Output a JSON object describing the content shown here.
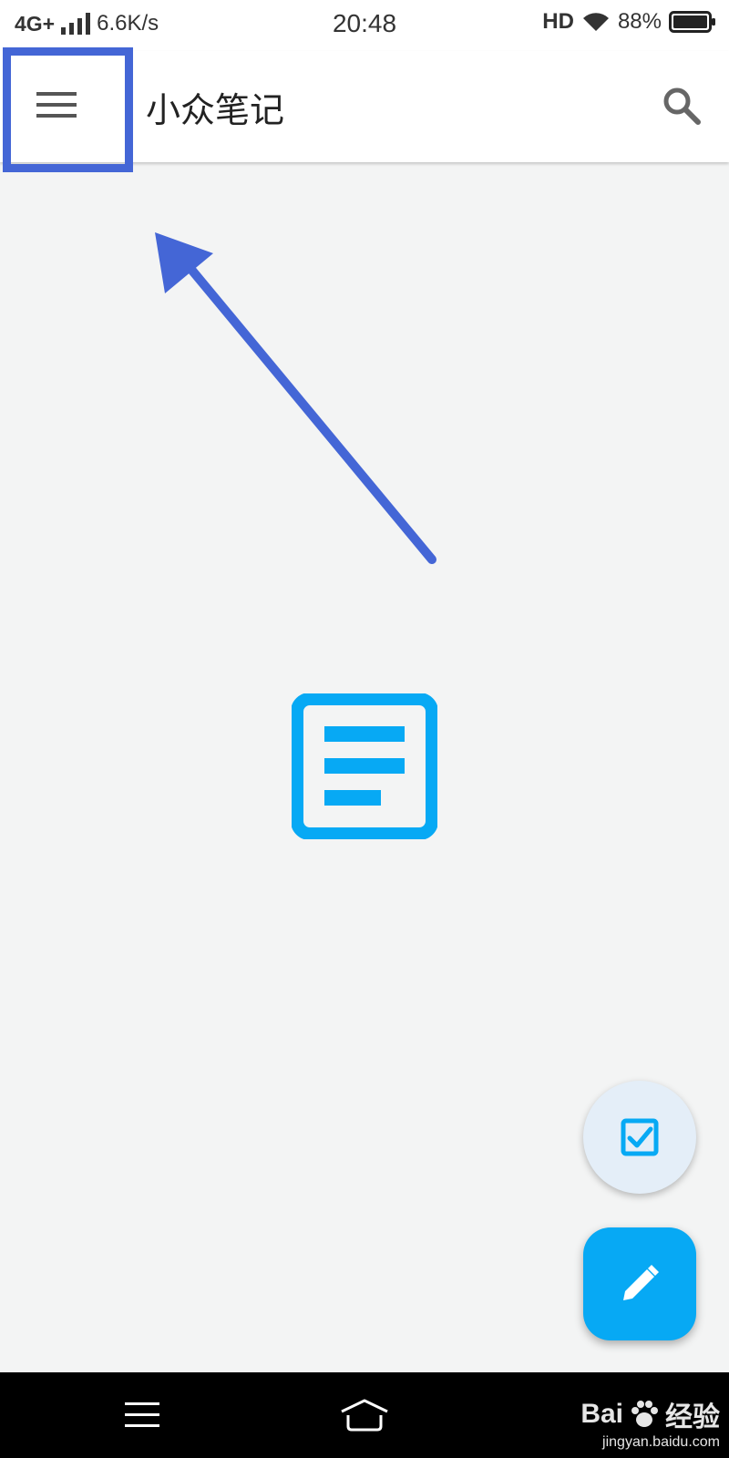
{
  "status_bar": {
    "network": "4G+",
    "speed": "6.6K/s",
    "time": "20:48",
    "hd": "HD",
    "battery": "88%"
  },
  "app_bar": {
    "title": "小众笔记",
    "menu_icon": "hamburger-menu-icon",
    "search_icon": "search-icon"
  },
  "empty_state": {
    "icon": "note-document-icon"
  },
  "fabs": {
    "checklist_icon": "checkbox-icon",
    "edit_icon": "pencil-icon"
  },
  "nav_bar": {
    "menu_icon": "nav-menu-icon",
    "home_icon": "nav-home-icon"
  },
  "watermark": {
    "brand": "Bai",
    "brand2": "经验",
    "site": "jingyan.baidu.com"
  },
  "colors": {
    "accent": "#07a9f4",
    "annotation": "#4466d6",
    "background": "#f3f4f4"
  }
}
